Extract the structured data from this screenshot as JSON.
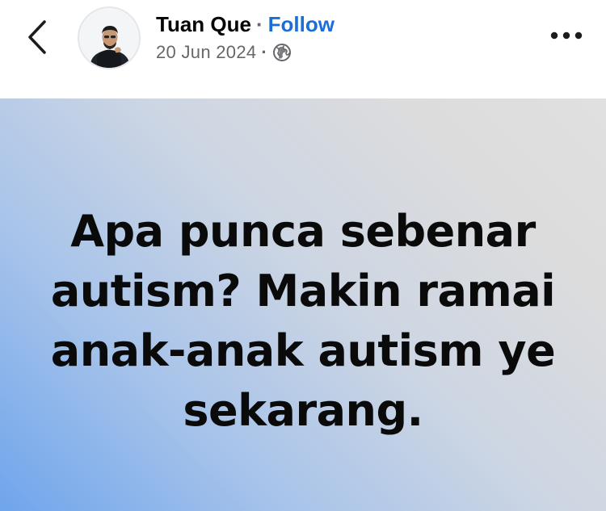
{
  "header": {
    "author_name": "Tuan Que",
    "separator": "·",
    "follow_label": "Follow",
    "date": "20 Jun 2024",
    "audience_icon": "globe-icon",
    "back_icon": "chevron-left-icon",
    "more_icon": "more-horizontal-icon"
  },
  "post": {
    "text": "Apa punca sebenar autism? Makin ramai anak-anak autism ye sekarang."
  },
  "colors": {
    "follow": "#1a6ed8",
    "meta_text": "#65676b",
    "gradient_start": "#6fa5ec",
    "gradient_end": "#e0e0e0"
  }
}
